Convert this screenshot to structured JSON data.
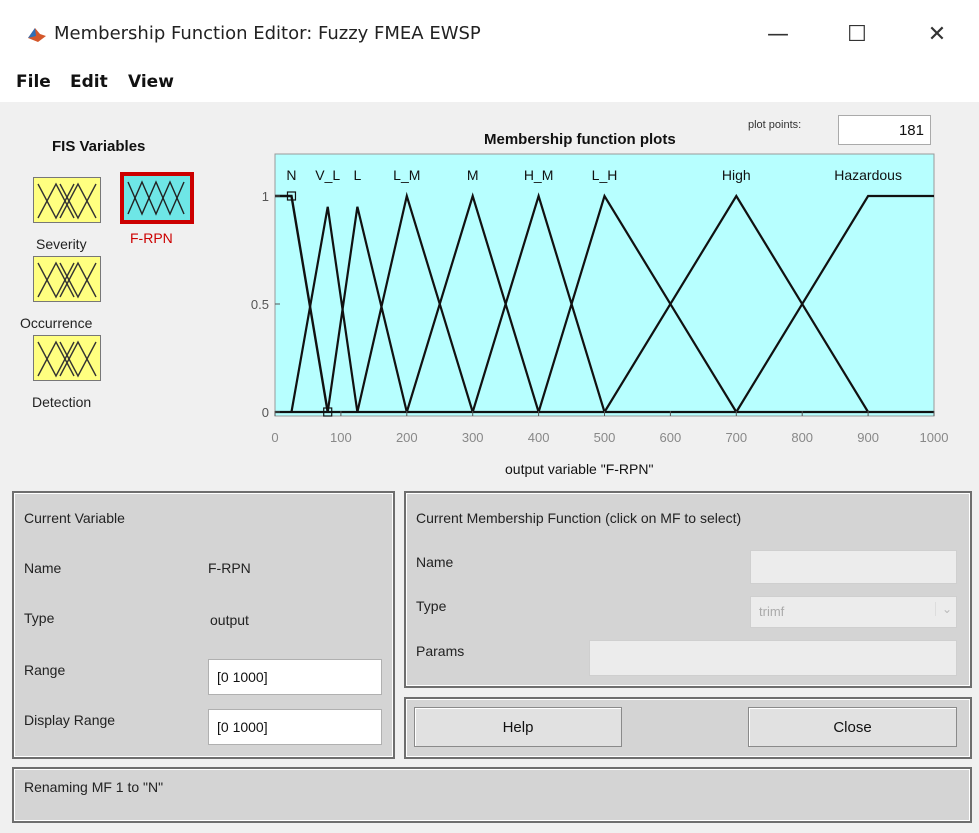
{
  "window": {
    "title": "Membership Function Editor: Fuzzy FMEA EWSP",
    "minimize": "—",
    "maximize": "☐",
    "close": "✕"
  },
  "menu": [
    "File",
    "Edit",
    "View"
  ],
  "fis": {
    "title": "FIS Variables",
    "variables": [
      {
        "label": "Severity",
        "selected": false
      },
      {
        "label": "F-RPN",
        "selected": true
      },
      {
        "label": "Occurrence",
        "selected": false
      },
      {
        "label": "Detection",
        "selected": false
      }
    ]
  },
  "plot": {
    "title": "Membership function plots",
    "plot_points_label": "plot points:",
    "plot_points_value": "181",
    "xlabel": "output variable \"F-RPN\"",
    "ytick_labels": [
      "1",
      "0.5",
      "0"
    ],
    "xtick_labels": [
      "0",
      "100",
      "200",
      "300",
      "400",
      "500",
      "600",
      "700",
      "800",
      "900",
      "1000"
    ],
    "mf_labels": [
      {
        "name": "N",
        "x": 25
      },
      {
        "name": "V_L",
        "x": 80
      },
      {
        "name": "L",
        "x": 125
      },
      {
        "name": "L_M",
        "x": 200
      },
      {
        "name": "M",
        "x": 300
      },
      {
        "name": "H_M",
        "x": 400
      },
      {
        "name": "L_H",
        "x": 500
      },
      {
        "name": "High",
        "x": 700
      },
      {
        "name": "Hazardous",
        "x": 900
      }
    ],
    "colors": {
      "background": "#b7ffff",
      "line": "#111111",
      "selected_icon": "#6ee6e6",
      "selected_border": "#cc0000",
      "selected_label": "#cc0000"
    }
  },
  "chart_data": {
    "type": "line",
    "title": "Membership function plots",
    "xlabel": "output variable \"F-RPN\"",
    "ylabel": "",
    "xlim": [
      0,
      1000
    ],
    "ylim": [
      0,
      1
    ],
    "grid": false,
    "series": [
      {
        "name": "N",
        "x": [
          0,
          25,
          80
        ],
        "y": [
          1,
          1,
          0
        ]
      },
      {
        "name": "V_L",
        "x": [
          25,
          80,
          125
        ],
        "y": [
          0,
          0.95,
          0
        ]
      },
      {
        "name": "L",
        "x": [
          80,
          125,
          200
        ],
        "y": [
          0,
          0.95,
          0
        ]
      },
      {
        "name": "L_M",
        "x": [
          125,
          200,
          300
        ],
        "y": [
          0,
          1,
          0
        ]
      },
      {
        "name": "M",
        "x": [
          200,
          300,
          400
        ],
        "y": [
          0,
          1,
          0
        ]
      },
      {
        "name": "H_M",
        "x": [
          300,
          400,
          500
        ],
        "y": [
          0,
          1,
          0
        ]
      },
      {
        "name": "L_H",
        "x": [
          400,
          500,
          700
        ],
        "y": [
          0,
          1,
          0
        ]
      },
      {
        "name": "High",
        "x": [
          500,
          700,
          900
        ],
        "y": [
          0,
          1,
          0
        ]
      },
      {
        "name": "Hazardous",
        "x": [
          700,
          900,
          1000
        ],
        "y": [
          0,
          1,
          1
        ]
      }
    ]
  },
  "current_variable": {
    "title": "Current Variable",
    "name_label": "Name",
    "name_value": "F-RPN",
    "type_label": "Type",
    "type_value": "output",
    "range_label": "Range",
    "range_value": "[0 1000]",
    "display_range_label": "Display Range",
    "display_range_value": "[0 1000]"
  },
  "current_mf": {
    "title": "Current Membership Function (click on MF to select)",
    "name_label": "Name",
    "name_value": "",
    "type_label": "Type",
    "type_value": "trimf",
    "params_label": "Params",
    "params_value": ""
  },
  "buttons": {
    "help": "Help",
    "close": "Close"
  },
  "status": "Renaming MF 1 to \"N\""
}
